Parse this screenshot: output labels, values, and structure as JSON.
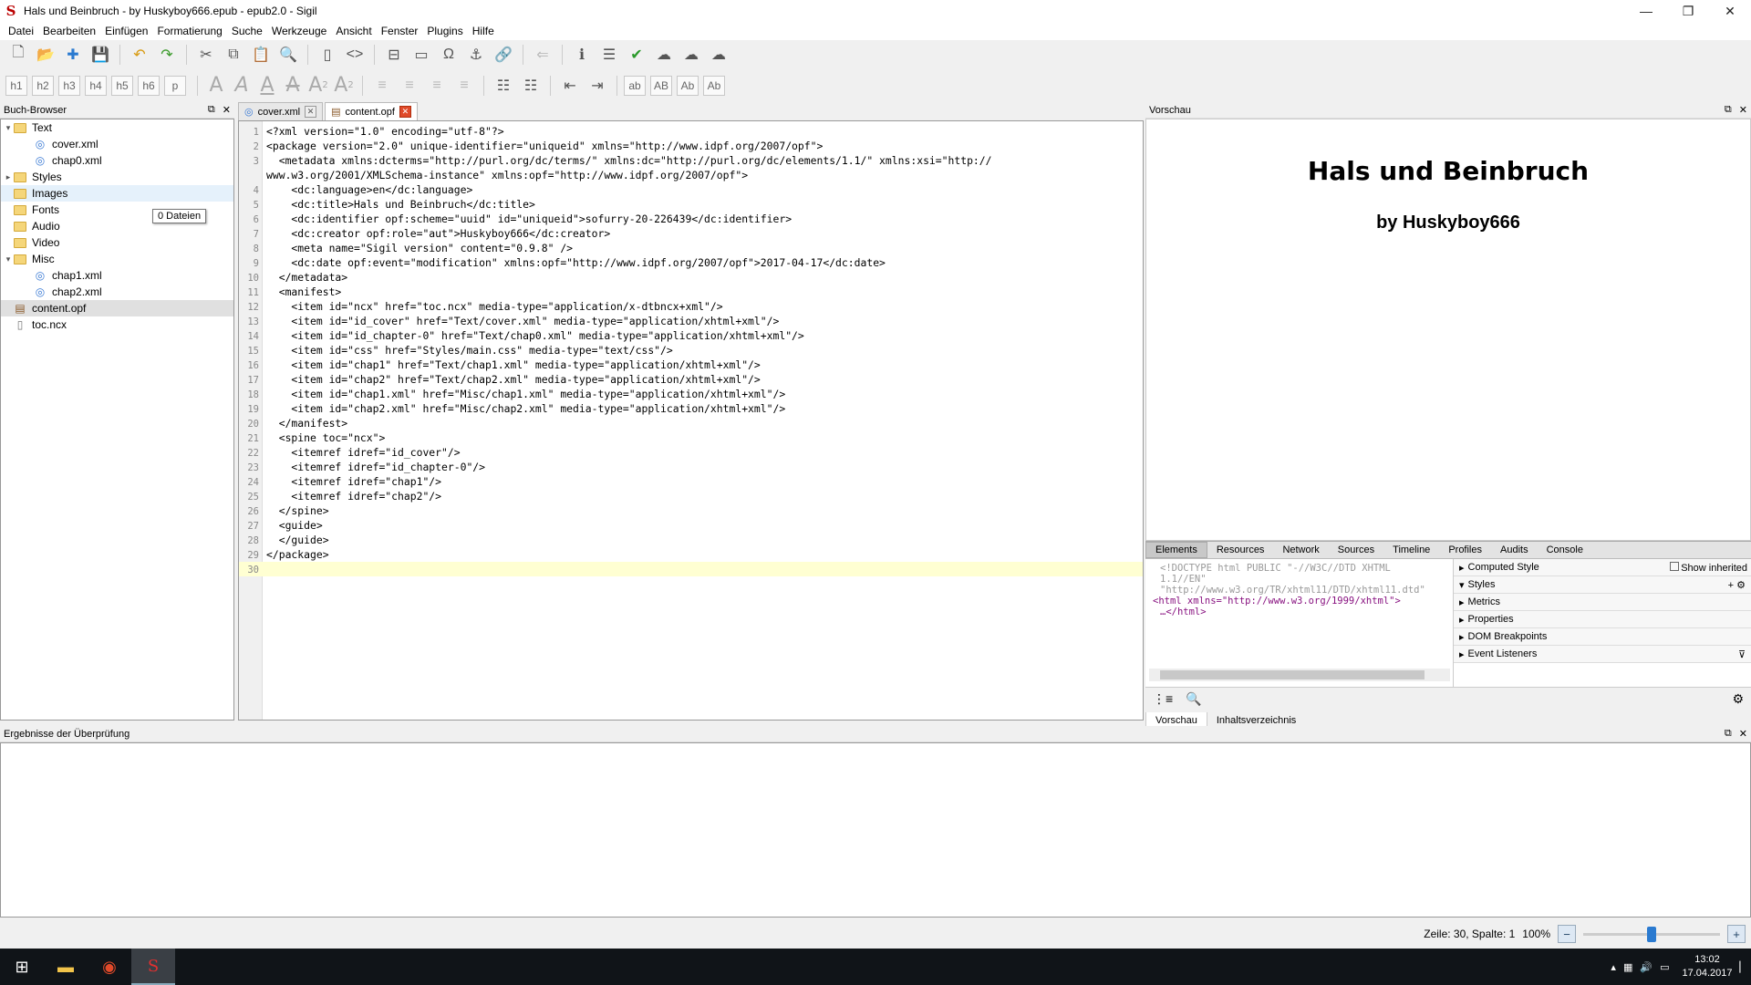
{
  "window": {
    "title": "Hals und Beinbruch - by Huskyboy666.epub - epub2.0 - Sigil"
  },
  "menu": [
    "Datei",
    "Bearbeiten",
    "Einfügen",
    "Formatierung",
    "Suche",
    "Werkzeuge",
    "Ansicht",
    "Fenster",
    "Plugins",
    "Hilfe"
  ],
  "heading_buttons": [
    "h1",
    "h2",
    "h3",
    "h4",
    "h5",
    "h6",
    "p"
  ],
  "case_buttons": [
    "ab",
    "AB",
    "Ab",
    "Ab"
  ],
  "book_browser": {
    "title": "Buch-Browser",
    "tooltip": "0 Dateien",
    "items": [
      {
        "label": "Text",
        "kind": "folder",
        "level": 0,
        "expanded": true
      },
      {
        "label": "cover.xml",
        "kind": "file",
        "level": 1
      },
      {
        "label": "chap0.xml",
        "kind": "file",
        "level": 1
      },
      {
        "label": "Styles",
        "kind": "folder",
        "level": 0,
        "expanded": false
      },
      {
        "label": "Images",
        "kind": "folder",
        "level": 0,
        "highlight": true
      },
      {
        "label": "Fonts",
        "kind": "folder",
        "level": 0
      },
      {
        "label": "Audio",
        "kind": "folder",
        "level": 0
      },
      {
        "label": "Video",
        "kind": "folder",
        "level": 0
      },
      {
        "label": "Misc",
        "kind": "folder",
        "level": 0,
        "expanded": true
      },
      {
        "label": "chap1.xml",
        "kind": "file",
        "level": 1
      },
      {
        "label": "chap2.xml",
        "kind": "file",
        "level": 1
      },
      {
        "label": "content.opf",
        "kind": "opf",
        "level": 0,
        "selected": true
      },
      {
        "label": "toc.ncx",
        "kind": "ncx",
        "level": 0
      }
    ]
  },
  "editor": {
    "tabs": [
      {
        "label": "cover.xml",
        "active": false
      },
      {
        "label": "content.opf",
        "active": true
      }
    ],
    "current_line": 30,
    "lines": [
      "<?xml version=\"1.0\" encoding=\"utf-8\"?>",
      "<package version=\"2.0\" unique-identifier=\"uniqueid\" xmlns=\"http://www.idpf.org/2007/opf\">",
      "  <metadata xmlns:dcterms=\"http://purl.org/dc/terms/\" xmlns:dc=\"http://purl.org/dc/elements/1.1/\" xmlns:xsi=\"http://",
      "    <dc:language>en</dc:language>",
      "    <dc:title>Hals und Beinbruch</dc:title>",
      "    <dc:identifier opf:scheme=\"uuid\" id=\"uniqueid\">sofurry-20-226439</dc:identifier>",
      "    <dc:creator opf:role=\"aut\">Huskyboy666</dc:creator>",
      "    <meta name=\"Sigil version\" content=\"0.9.8\" />",
      "    <dc:date opf:event=\"modification\" xmlns:opf=\"http://www.idpf.org/2007/opf\">2017-04-17</dc:date>",
      "  </metadata>",
      "  <manifest>",
      "    <item id=\"ncx\" href=\"toc.ncx\" media-type=\"application/x-dtbncx+xml\"/>",
      "    <item id=\"id_cover\" href=\"Text/cover.xml\" media-type=\"application/xhtml+xml\"/>",
      "    <item id=\"id_chapter-0\" href=\"Text/chap0.xml\" media-type=\"application/xhtml+xml\"/>",
      "    <item id=\"css\" href=\"Styles/main.css\" media-type=\"text/css\"/>",
      "    <item id=\"chap1\" href=\"Text/chap1.xml\" media-type=\"application/xhtml+xml\"/>",
      "    <item id=\"chap2\" href=\"Text/chap2.xml\" media-type=\"application/xhtml+xml\"/>",
      "    <item id=\"chap1.xml\" href=\"Misc/chap1.xml\" media-type=\"application/xhtml+xml\"/>",
      "    <item id=\"chap2.xml\" href=\"Misc/chap2.xml\" media-type=\"application/xhtml+xml\"/>",
      "  </manifest>",
      "  <spine toc=\"ncx\">",
      "    <itemref idref=\"id_cover\"/>",
      "    <itemref idref=\"id_chapter-0\"/>",
      "    <itemref idref=\"chap1\"/>",
      "    <itemref idref=\"chap2\"/>",
      "  </spine>",
      "  <guide>",
      "  </guide>",
      "</package>",
      ""
    ],
    "wrap_line_3": "www.w3.org/2001/XMLSchema-instance\" xmlns:opf=\"http://www.idpf.org/2007/opf\">"
  },
  "preview": {
    "title": "Vorschau",
    "heading": "Hals und Beinbruch",
    "subheading": "by Huskyboy666",
    "devtools_tabs": [
      "Elements",
      "Resources",
      "Network",
      "Sources",
      "Timeline",
      "Profiles",
      "Audits",
      "Console"
    ],
    "dom_lines": [
      "<!DOCTYPE html PUBLIC \"-//W3C//DTD XHTML",
      "1.1//EN\"",
      "\"http://www.w3.org/TR/xhtml11/DTD/xhtml11.dtd\"",
      "<html xmlns=\"http://www.w3.org/1999/xhtml\">",
      "…</html>"
    ],
    "side_sections": [
      "Computed Style",
      "Styles",
      "Metrics",
      "Properties",
      "DOM Breakpoints",
      "Event Listeners"
    ],
    "show_inherited": "Show inherited",
    "bottom_tabs": [
      "Vorschau",
      "Inhaltsverzeichnis"
    ]
  },
  "results": {
    "title": "Ergebnisse der Überprüfung"
  },
  "status": {
    "position": "Zeile: 30, Spalte: 1",
    "zoom": "100%",
    "zoom_level": 0.5
  },
  "taskbar": {
    "time": "13:02",
    "date": "17.04.2017"
  }
}
